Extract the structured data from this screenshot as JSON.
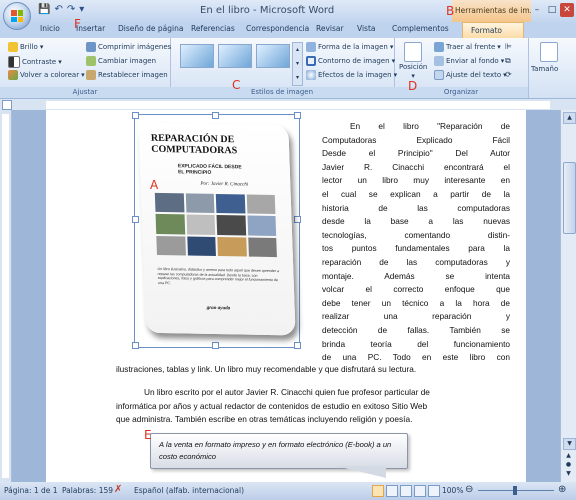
{
  "window": {
    "title": "En el libro - Microsoft Word",
    "contextual_tab_title": "Herramientas de im...",
    "controls": [
      "–",
      "□",
      "✕"
    ]
  },
  "tabs": [
    "Inicio",
    "Insertar",
    "Diseño de página",
    "Referencias",
    "Correspondencia",
    "Revisar",
    "Vista",
    "Complementos",
    "Formato"
  ],
  "ribbon": {
    "ajustar": {
      "label": "Ajustar",
      "items": [
        "Brillo",
        "Contraste",
        "Volver a colorear",
        "Comprimir imágenes",
        "Cambiar imagen",
        "Restablecer imagen"
      ]
    },
    "estilos": {
      "label": "Estilos de imagen",
      "items": [
        "Forma de la imagen",
        "Contorno de imagen",
        "Efectos de la imagen"
      ]
    },
    "organizar": {
      "label": "Organizar",
      "posicion": "Posición",
      "items": [
        "Traer al frente",
        "Enviar al fondo",
        "Ajuste del texto"
      ]
    },
    "tamano": {
      "label": "Tamaño"
    }
  },
  "annotations": [
    "A",
    "B",
    "C",
    "D",
    "E",
    "F"
  ],
  "book_cover": {
    "title": "REPARACIÓN DE COMPUTADORAS",
    "subtitle": "EXPLICADO FÁCIL DESDE EL PRINCIPIO",
    "author": "Por: Javier R. Cinacchi",
    "blurb": "Un libro ilustrativo, didáctico y ameno para todo aquel que desee aprender a reparar las computadoras de la actualidad. Desde la base, con explicaciones, fotos y gráficos para comprender mejor el funcionamiento de una PC.",
    "cta": "gran ayuda"
  },
  "document": {
    "para1_lines": [
      "En el libro \"Reparación de",
      "Computadoras Explicado Fácil",
      "Desde el Principio\" Del Autor",
      "Javier R. Cinacchi encontrará el",
      "lector un libro muy interesante en",
      "el cual se explican a partir de la",
      "historia de las computadoras",
      "desde la base a las nuevas",
      "tecnologías, comentando distin-",
      "tos puntos fundamentales para la",
      "reparación de las computadoras y",
      "montaje. Además se intenta",
      "volcar el correcto enfoque que",
      "debe tener un técnico a la hora de",
      "realizar una reparación y",
      "detección de fallas. También se",
      "brinda teoría del funcionamiento",
      "de una PC. Todo en este libro con"
    ],
    "para1_tail": "ilustraciones, tablas y link. Un libro muy recomendable y que disfrutará su lectura.",
    "para2_lines": [
      "Un libro escrito por el autor Javier R. Cinacchi quien fue profesor particular de",
      "informática por años y actual redactor de contenidos de estudio en exitoso Sitio Web",
      "que administra. También escribe en otras temáticas incluyendo religión y poesía."
    ],
    "callout": "A la venta en formato impreso y en formato electrónico (E-book) a un costo económico"
  },
  "status": {
    "page": "Página: 1 de 1",
    "words": "Palabras: 159",
    "language": "Español (alfab. internacional)",
    "zoom": "100%"
  }
}
